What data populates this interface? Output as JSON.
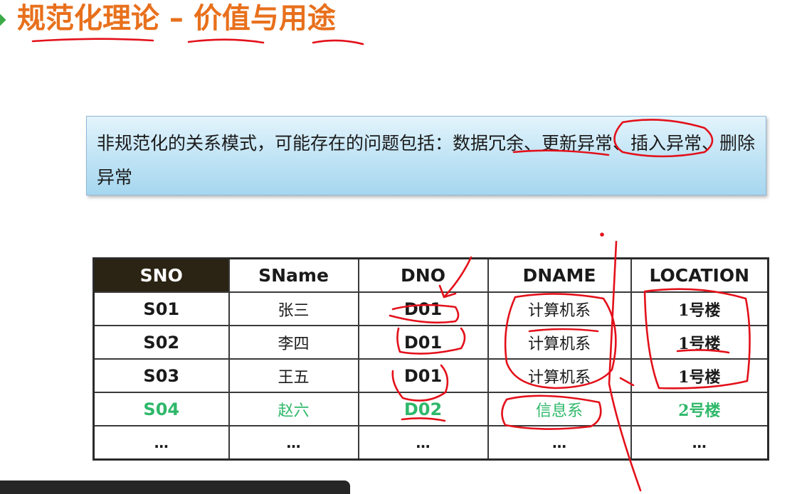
{
  "slide": {
    "title": "规范化理论 – 价值与用途",
    "callout_text": "非规范化的关系模式，可能存在的问题包括：数据冗余、更新异常、插入异常、删除异常"
  },
  "table": {
    "headers": {
      "sno": "SNO",
      "sname": "SName",
      "dno": "DNO",
      "dname": "DNAME",
      "location": "LOCATION"
    },
    "rows": [
      {
        "sno": "S01",
        "sname": "张三",
        "dno": "D01",
        "dname": "计算机系",
        "location": "1号楼"
      },
      {
        "sno": "S02",
        "sname": "李四",
        "dno": "D01",
        "dname": "计算机系",
        "location": "1号楼"
      },
      {
        "sno": "S03",
        "sname": "王五",
        "dno": "D01",
        "dname": "计算机系",
        "location": "1号楼"
      },
      {
        "sno": "S04",
        "sname": "赵六",
        "dno": "D02",
        "dname": "信息系",
        "location": "2号楼"
      },
      {
        "sno": "…",
        "sname": "…",
        "dno": "…",
        "dname": "…",
        "location": "…"
      }
    ]
  },
  "colors": {
    "title": "#e8701c",
    "highlight_row": "#2fb86a",
    "header_dark": "#2b2313",
    "annotation_ink": "#e3101a",
    "callout_fill": "#bfe3f5"
  }
}
